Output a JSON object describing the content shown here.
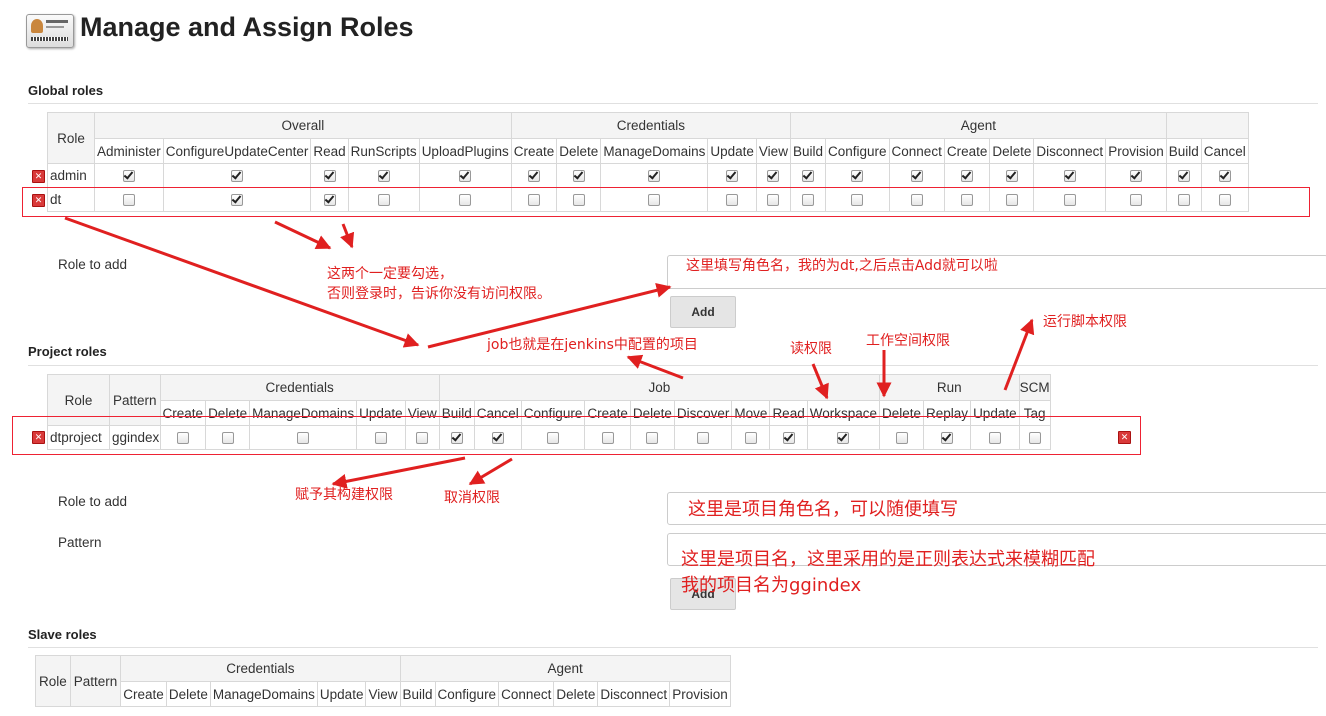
{
  "page": {
    "title": "Manage and Assign Roles"
  },
  "global": {
    "section_title": "Global roles",
    "role_header": "Role",
    "groups": [
      "Overall",
      "Credentials",
      "Agent",
      ""
    ],
    "permissions": [
      "Administer",
      "ConfigureUpdateCenter",
      "Read",
      "RunScripts",
      "UploadPlugins",
      "Create",
      "Delete",
      "ManageDomains",
      "Update",
      "View",
      "Build",
      "Configure",
      "Connect",
      "Create",
      "Delete",
      "Disconnect",
      "Provision",
      "Build",
      "Cancel"
    ],
    "rows": [
      {
        "name": "admin",
        "checks": [
          1,
          1,
          1,
          1,
          1,
          1,
          1,
          1,
          1,
          1,
          1,
          1,
          1,
          1,
          1,
          1,
          1,
          1,
          1
        ]
      },
      {
        "name": "dt",
        "checks": [
          0,
          1,
          1,
          0,
          0,
          0,
          0,
          0,
          0,
          0,
          0,
          0,
          0,
          0,
          0,
          0,
          0,
          0,
          0
        ]
      }
    ],
    "role_to_add_label": "Role to add",
    "add_button": "Add"
  },
  "project": {
    "section_title": "Project roles",
    "role_header": "Role",
    "pattern_header": "Pattern",
    "groups": [
      "Credentials",
      "Job",
      "Run",
      "SCM"
    ],
    "permissions": [
      "Create",
      "Delete",
      "ManageDomains",
      "Update",
      "View",
      "Build",
      "Cancel",
      "Configure",
      "Create",
      "Delete",
      "Discover",
      "Move",
      "Read",
      "Workspace",
      "Delete",
      "Replay",
      "Update",
      "Tag"
    ],
    "rows": [
      {
        "name": "dtproject",
        "pattern": "ggindex",
        "checks": [
          0,
          0,
          0,
          0,
          0,
          1,
          1,
          0,
          0,
          0,
          0,
          0,
          1,
          1,
          0,
          1,
          0,
          0
        ]
      }
    ],
    "role_to_add_label": "Role to add",
    "pattern_label": "Pattern",
    "add_button": "Add"
  },
  "slave": {
    "section_title": "Slave roles",
    "role_header": "Role",
    "pattern_header": "Pattern",
    "groups": [
      "Credentials",
      "Agent"
    ],
    "permissions": [
      "Create",
      "Delete",
      "ManageDomains",
      "Update",
      "View",
      "Build",
      "Configure",
      "Connect",
      "Delete",
      "Disconnect",
      "Provision"
    ]
  },
  "annotations": {
    "must_check_1": "这两个一定要勾选，",
    "must_check_2": "否则登录时，告诉你没有访问权限。",
    "role_name_hint": "这里填写角色名，我的为dt,之后点击Add就可以啦",
    "job_hint": "job也就是在jenkins中配置的项目",
    "read_perm": "读权限",
    "workspace_perm": "工作空间权限",
    "run_script_perm": "运行脚本权限",
    "build_perm": "赋予其构建权限",
    "cancel_perm": "取消权限",
    "project_role_hint": "这里是项目角色名，可以随便填写",
    "project_name_hint_1": "这里是项目名，这里采用的是正则表达式来模糊匹配",
    "project_name_hint_2": "我的项目名为ggindex"
  },
  "colors": {
    "annotation": "#e02020",
    "header_bg": "#f4f4f4",
    "delete_icon": "#d93a3a"
  }
}
